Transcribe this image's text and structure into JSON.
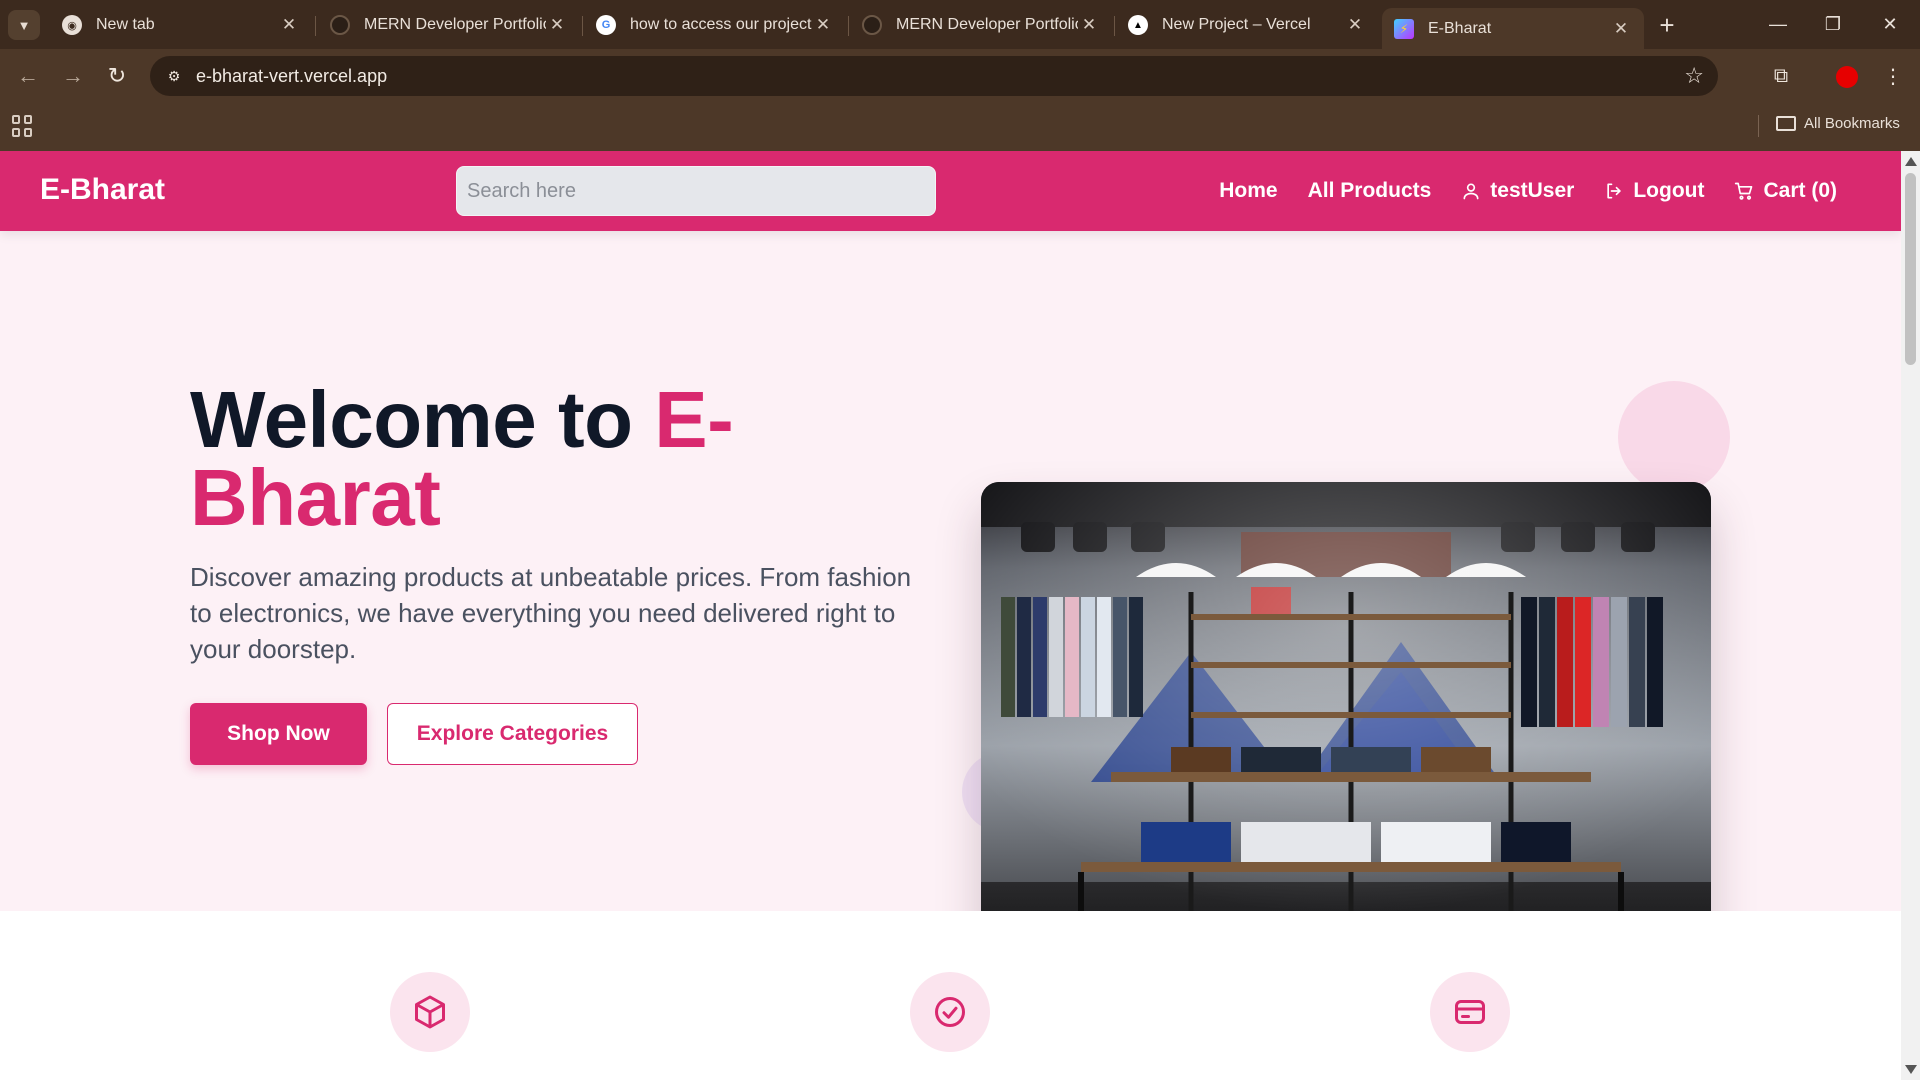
{
  "browser": {
    "tabs": [
      {
        "title": "New tab",
        "favicon": "chrome-icon",
        "active": false
      },
      {
        "title": "MERN Developer Portfolio",
        "favicon": "github-icon",
        "active": false
      },
      {
        "title": "how to access our project on",
        "favicon": "google-icon",
        "active": false
      },
      {
        "title": "MERN Developer Portfolio",
        "favicon": "github-icon",
        "active": false
      },
      {
        "title": "New Project – Vercel",
        "favicon": "vercel-icon",
        "active": false
      },
      {
        "title": "E-Bharat",
        "favicon": "vite-icon",
        "active": true
      }
    ],
    "url": "e-bharat-vert.vercel.app",
    "bookmarks_label": "All Bookmarks",
    "profile_color": "#e60000"
  },
  "site": {
    "brand": "E-Bharat",
    "search_placeholder": "Search here",
    "nav": {
      "home": "Home",
      "all_products": "All Products",
      "user": "testUser",
      "logout": "Logout",
      "cart": "Cart (0)"
    },
    "hero": {
      "title_main": "Welcome to ",
      "title_accent": "E-Bharat",
      "description": "Discover amazing products at unbeatable prices. From fashion to electronics, we have everything you need delivered right to your doorstep.",
      "primary_button": "Shop Now",
      "secondary_button": "Explore Categories"
    },
    "features": [
      {
        "icon": "box-icon"
      },
      {
        "icon": "check-circle-icon"
      },
      {
        "icon": "credit-card-icon"
      }
    ],
    "colors": {
      "brand_pink": "#d9296f",
      "hero_background": "#fdf1f6",
      "heading_dark": "#101828",
      "feature_circle": "#fbe4ee"
    }
  }
}
